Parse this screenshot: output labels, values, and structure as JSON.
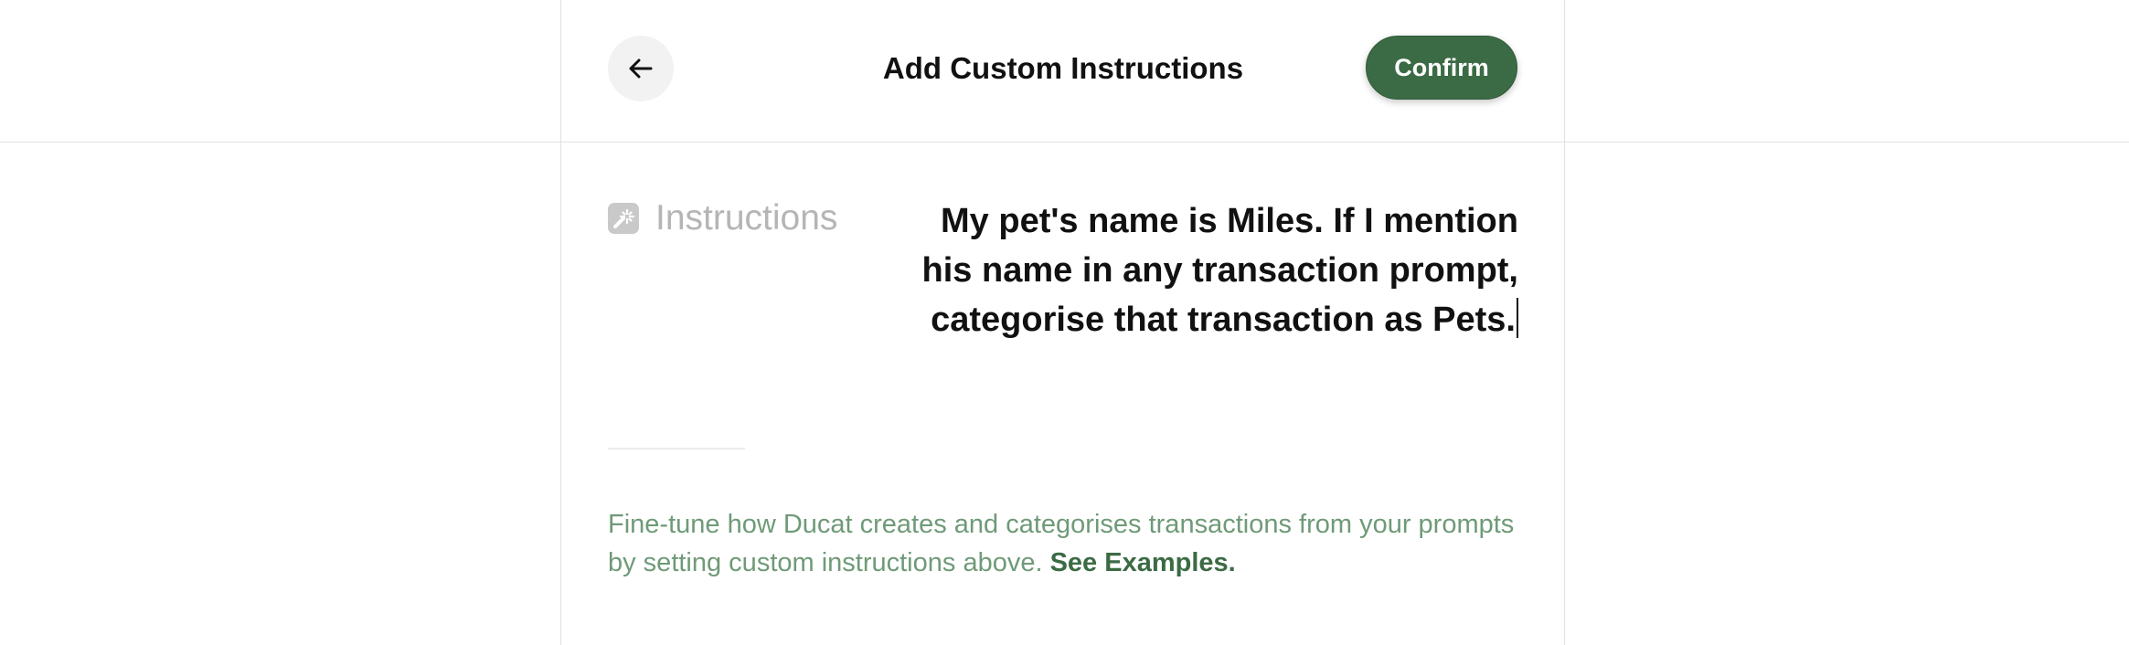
{
  "header": {
    "title": "Add Custom Instructions",
    "confirm_label": "Confirm",
    "back_icon": "arrow-left-icon"
  },
  "field": {
    "icon": "magic-wand-icon",
    "label": "Instructions",
    "value": "My pet's name is Miles. If I mention his name in any transaction prompt, categorise that transaction as Pets."
  },
  "help": {
    "text": "Fine-tune how Ducat creates and categorises transactions from your prompts by setting custom instructions above. ",
    "link_label": "See Examples."
  },
  "colors": {
    "accent": "#3b6b44",
    "help_text": "#6f9a78",
    "divider": "#e2e2e2",
    "placeholder": "#b5b5b5"
  }
}
